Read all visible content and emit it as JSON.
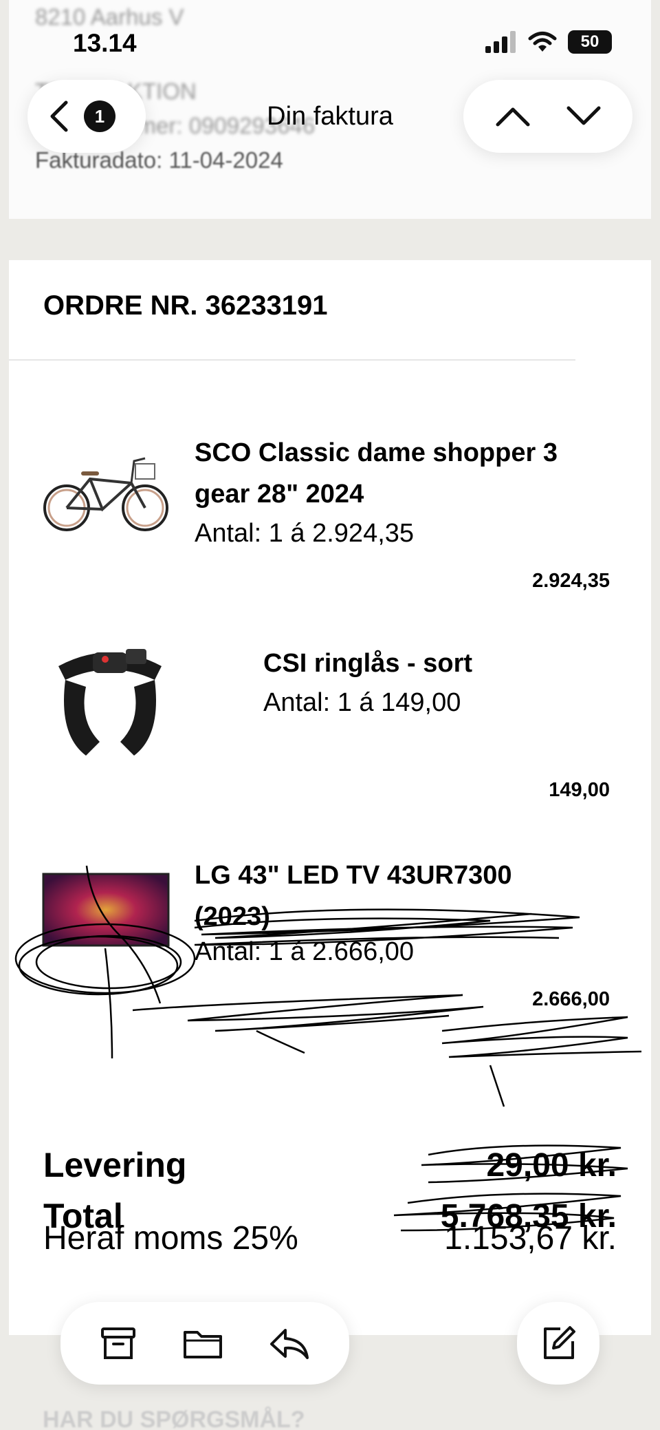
{
  "status_bar": {
    "time": "13.14",
    "battery": "50"
  },
  "background_invoice": {
    "address": "8210 Aarhus V",
    "label": "TRANSAKTION",
    "order_number_label": "Ordrenummer: 0909293646",
    "invoice_date": "Fakturadato: 11-04-2024"
  },
  "nav": {
    "title": "Din faktura",
    "back_badge": "1"
  },
  "order": {
    "number_label": "ORDRE NR. 36233191",
    "items": [
      {
        "name_line1": "SCO Classic dame shopper 3",
        "name_line2": "gear 28\" 2024",
        "quantity": "Antal: 1 á 2.924,35",
        "price": "2.924,35",
        "image": "bicycle-image"
      },
      {
        "name_line1": "CSI ringlås - sort",
        "name_line2": "",
        "quantity": "Antal: 1 á 149,00",
        "price": "149,00",
        "image": "ring-lock-image"
      },
      {
        "name_line1": "LG 43\" LED TV 43UR7300",
        "name_line2": "(2023)",
        "quantity": "Antal: 1 á 2.666,00",
        "price": "2.666,00",
        "image": "tv-image",
        "scribbled_out": true
      }
    ],
    "summary": {
      "delivery_label": "Levering",
      "delivery_value": "29,00 kr.",
      "total_label": "Total",
      "total_value": "5.768,35 kr.",
      "vat_label": "Heraf moms 25%",
      "vat_value": "1.153,67 kr."
    }
  },
  "footer_faded": "HAR DU SPØRGSMÅL?",
  "toolbar": {
    "icons": [
      "archive-icon",
      "folder-icon",
      "reply-icon",
      "compose-icon"
    ]
  }
}
